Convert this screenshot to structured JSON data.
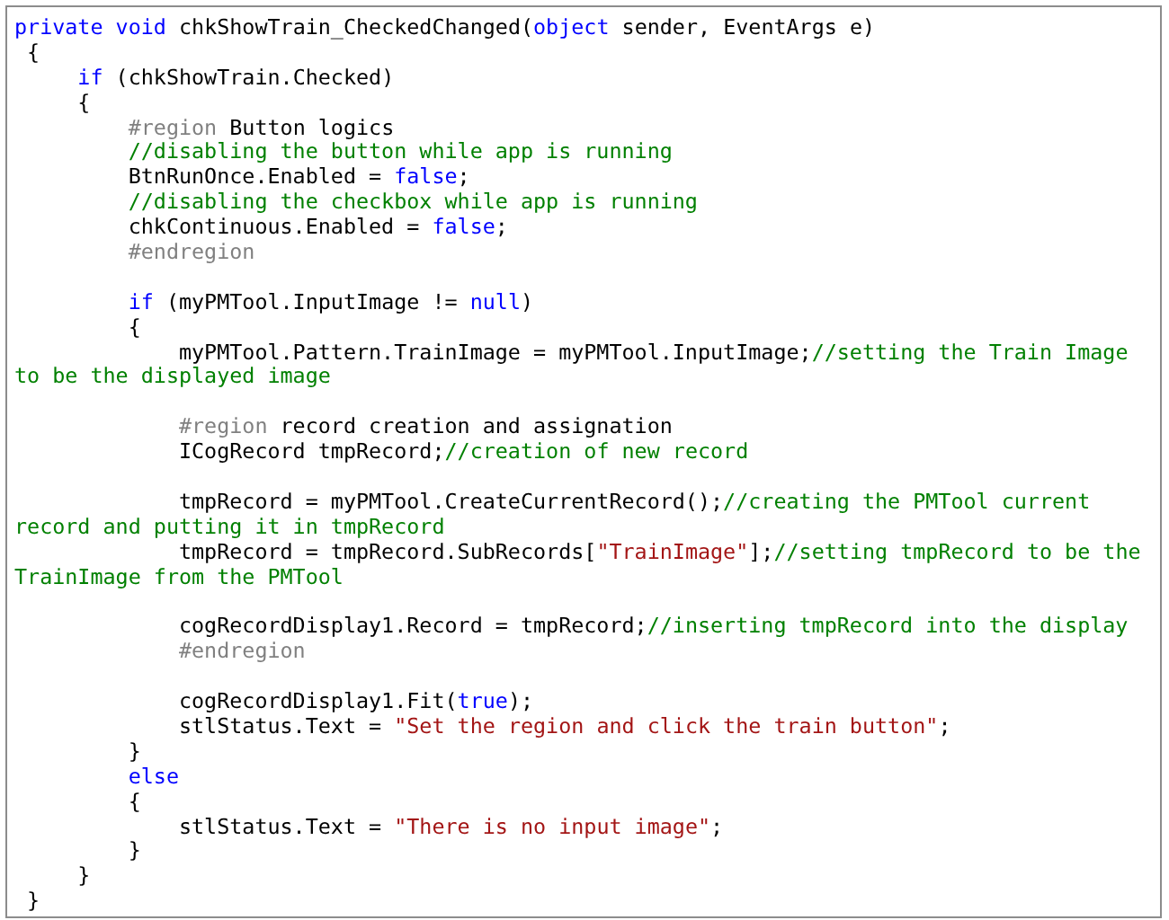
{
  "code_lines": [
    {
      "kind": "code",
      "segments": [
        {
          "kind": "keyword",
          "text": "private void"
        },
        {
          "kind": "plain",
          "text": " chkShowTrain_CheckedChanged("
        },
        {
          "kind": "keyword",
          "text": "object"
        },
        {
          "kind": "plain",
          "text": " sender, EventArgs e)"
        }
      ]
    },
    {
      "kind": "code",
      "segments": [
        {
          "kind": "plain",
          "text": " {"
        }
      ]
    },
    {
      "kind": "code",
      "segments": [
        {
          "kind": "keyword",
          "text": "     if"
        },
        {
          "kind": "plain",
          "text": " (chkShowTrain.Checked)"
        }
      ]
    },
    {
      "kind": "code",
      "segments": [
        {
          "kind": "plain",
          "text": "     {"
        }
      ]
    },
    {
      "kind": "code",
      "segments": [
        {
          "kind": "directive",
          "text": "         #region"
        },
        {
          "kind": "plain",
          "text": " Button logics"
        }
      ]
    },
    {
      "kind": "code",
      "segments": [
        {
          "kind": "comment",
          "text": "         //disabling the button while app is running"
        }
      ]
    },
    {
      "kind": "code",
      "segments": [
        {
          "kind": "plain",
          "text": "         BtnRunOnce.Enabled = "
        },
        {
          "kind": "keyword",
          "text": "false"
        },
        {
          "kind": "plain",
          "text": ";"
        }
      ]
    },
    {
      "kind": "code",
      "segments": [
        {
          "kind": "comment",
          "text": "         //disabling the checkbox while app is running"
        }
      ]
    },
    {
      "kind": "code",
      "segments": [
        {
          "kind": "plain",
          "text": "         chkContinuous.Enabled = "
        },
        {
          "kind": "keyword",
          "text": "false"
        },
        {
          "kind": "plain",
          "text": ";"
        }
      ]
    },
    {
      "kind": "code",
      "segments": [
        {
          "kind": "directive",
          "text": "         #endregion"
        }
      ]
    },
    {
      "kind": "blank"
    },
    {
      "kind": "code",
      "segments": [
        {
          "kind": "keyword",
          "text": "         if"
        },
        {
          "kind": "plain",
          "text": " (myPMTool.InputImage != "
        },
        {
          "kind": "keyword",
          "text": "null"
        },
        {
          "kind": "plain",
          "text": ")"
        }
      ]
    },
    {
      "kind": "code",
      "segments": [
        {
          "kind": "plain",
          "text": "         {"
        }
      ]
    },
    {
      "kind": "code",
      "segments": [
        {
          "kind": "plain",
          "text": "             myPMTool.Pattern.TrainImage = myPMTool.InputImage;"
        },
        {
          "kind": "comment",
          "text": "//setting the Train Image"
        }
      ]
    },
    {
      "kind": "code",
      "segments": [
        {
          "kind": "comment",
          "text": "to be the displayed image"
        }
      ]
    },
    {
      "kind": "blank"
    },
    {
      "kind": "code",
      "segments": [
        {
          "kind": "directive",
          "text": "             #region"
        },
        {
          "kind": "plain",
          "text": " record creation and assignation"
        }
      ]
    },
    {
      "kind": "code",
      "segments": [
        {
          "kind": "plain",
          "text": "             ICogRecord tmpRecord;"
        },
        {
          "kind": "comment",
          "text": "//creation of new record"
        }
      ]
    },
    {
      "kind": "blank"
    },
    {
      "kind": "code",
      "segments": [
        {
          "kind": "plain",
          "text": "             tmpRecord = myPMTool.CreateCurrentRecord();"
        },
        {
          "kind": "comment",
          "text": "//creating the PMTool current"
        }
      ]
    },
    {
      "kind": "code",
      "segments": [
        {
          "kind": "comment",
          "text": "record and putting it in tmpRecord"
        }
      ]
    },
    {
      "kind": "code",
      "segments": [
        {
          "kind": "plain",
          "text": "             tmpRecord = tmpRecord.SubRecords["
        },
        {
          "kind": "string",
          "text": "\"TrainImage\""
        },
        {
          "kind": "plain",
          "text": "];"
        },
        {
          "kind": "comment",
          "text": "//setting tmpRecord to be the"
        }
      ]
    },
    {
      "kind": "code",
      "segments": [
        {
          "kind": "comment",
          "text": "TrainImage from the PMTool"
        }
      ]
    },
    {
      "kind": "blank"
    },
    {
      "kind": "code",
      "segments": [
        {
          "kind": "plain",
          "text": "             cogRecordDisplay1.Record = tmpRecord;"
        },
        {
          "kind": "comment",
          "text": "//inserting tmpRecord into the display"
        }
      ]
    },
    {
      "kind": "code",
      "segments": [
        {
          "kind": "directive",
          "text": "             #endregion"
        }
      ]
    },
    {
      "kind": "blank"
    },
    {
      "kind": "code",
      "segments": [
        {
          "kind": "plain",
          "text": "             cogRecordDisplay1.Fit("
        },
        {
          "kind": "keyword",
          "text": "true"
        },
        {
          "kind": "plain",
          "text": ");"
        }
      ]
    },
    {
      "kind": "code",
      "segments": [
        {
          "kind": "plain",
          "text": "             stlStatus.Text = "
        },
        {
          "kind": "string",
          "text": "\"Set the region and click the train button\""
        },
        {
          "kind": "plain",
          "text": ";"
        }
      ]
    },
    {
      "kind": "code",
      "segments": [
        {
          "kind": "plain",
          "text": "         }"
        }
      ]
    },
    {
      "kind": "code",
      "segments": [
        {
          "kind": "keyword",
          "text": "         else"
        }
      ]
    },
    {
      "kind": "code",
      "segments": [
        {
          "kind": "plain",
          "text": "         {"
        }
      ]
    },
    {
      "kind": "code",
      "segments": [
        {
          "kind": "plain",
          "text": "             stlStatus.Text = "
        },
        {
          "kind": "string",
          "text": "\"There is no input image\""
        },
        {
          "kind": "plain",
          "text": ";"
        }
      ]
    },
    {
      "kind": "code",
      "segments": [
        {
          "kind": "plain",
          "text": "         }"
        }
      ]
    },
    {
      "kind": "code",
      "segments": [
        {
          "kind": "plain",
          "text": "     }"
        }
      ]
    },
    {
      "kind": "code",
      "segments": [
        {
          "kind": "plain",
          "text": " }"
        }
      ]
    }
  ]
}
